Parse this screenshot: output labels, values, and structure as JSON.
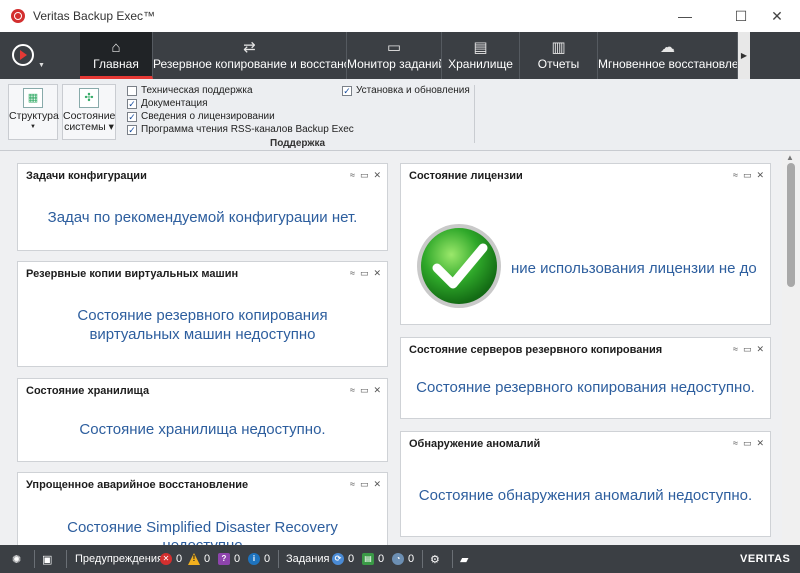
{
  "window": {
    "title": "Veritas Backup Exec™"
  },
  "tabs": [
    {
      "label": "Главная",
      "icon": "home-icon",
      "glyph": "⌂"
    },
    {
      "label": "Резервное копирование и восстанов",
      "icon": "backup-restore-icon",
      "glyph": "⇄"
    },
    {
      "label": "Монитор заданий",
      "icon": "job-monitor-icon",
      "glyph": "▭"
    },
    {
      "label": "Хранилище",
      "icon": "storage-icon",
      "glyph": "▤"
    },
    {
      "label": "Отчеты",
      "icon": "reports-icon",
      "glyph": "▥"
    },
    {
      "label": "Мгновенное восстановлени",
      "icon": "instant-recovery-icon",
      "glyph": "☁"
    }
  ],
  "ribbon": {
    "structure_label": "Структура",
    "system_state_label_1": "Состояние",
    "system_state_label_2": "системы",
    "checks": [
      {
        "label": "Техническая поддержка",
        "checked": false
      },
      {
        "label": "Документация",
        "checked": true
      },
      {
        "label": "Сведения о лицензировании",
        "checked": true
      },
      {
        "label": "Программа чтения RSS-каналов Backup Exec",
        "checked": true
      },
      {
        "label": "Установка и обновления",
        "checked": true
      }
    ],
    "group_label": "Поддержка"
  },
  "cards": {
    "config_tasks": {
      "title": "Задачи конфигурации",
      "message": "Задач по рекомендуемой конфигурации нет."
    },
    "vm_backups": {
      "title": "Резервные копии виртуальных машин",
      "message_1": "Состояние резервного копирования",
      "message_2": "виртуальных машин недоступно"
    },
    "storage_state": {
      "title": "Состояние хранилища",
      "message": "Состояние хранилища недоступно."
    },
    "sdr": {
      "title": "Упрощенное аварийное восстановление",
      "message_1": "Состояние Simplified Disaster Recovery",
      "message_2": "недоступно"
    },
    "license_state": {
      "title": "Состояние лицензии",
      "message": "ние использования лицензии не до"
    },
    "backup_servers": {
      "title": "Состояние серверов резервного копирования",
      "message": "Состояние резервного копирования недоступно."
    },
    "anomaly": {
      "title": "Обнаружение аномалий",
      "message": "Состояние обнаружения аномалий недоступно."
    }
  },
  "status": {
    "alerts_label": "Предупреждения",
    "alert_counts": [
      "0",
      "0",
      "0",
      "0"
    ],
    "jobs_label": "Задания",
    "job_counts": [
      "0",
      "0",
      "0"
    ],
    "brand": "VERITAS"
  },
  "colors": {
    "accent": "#e53935",
    "message_text": "#2d5e9e",
    "ribbon_dark": "#3b3f44"
  }
}
